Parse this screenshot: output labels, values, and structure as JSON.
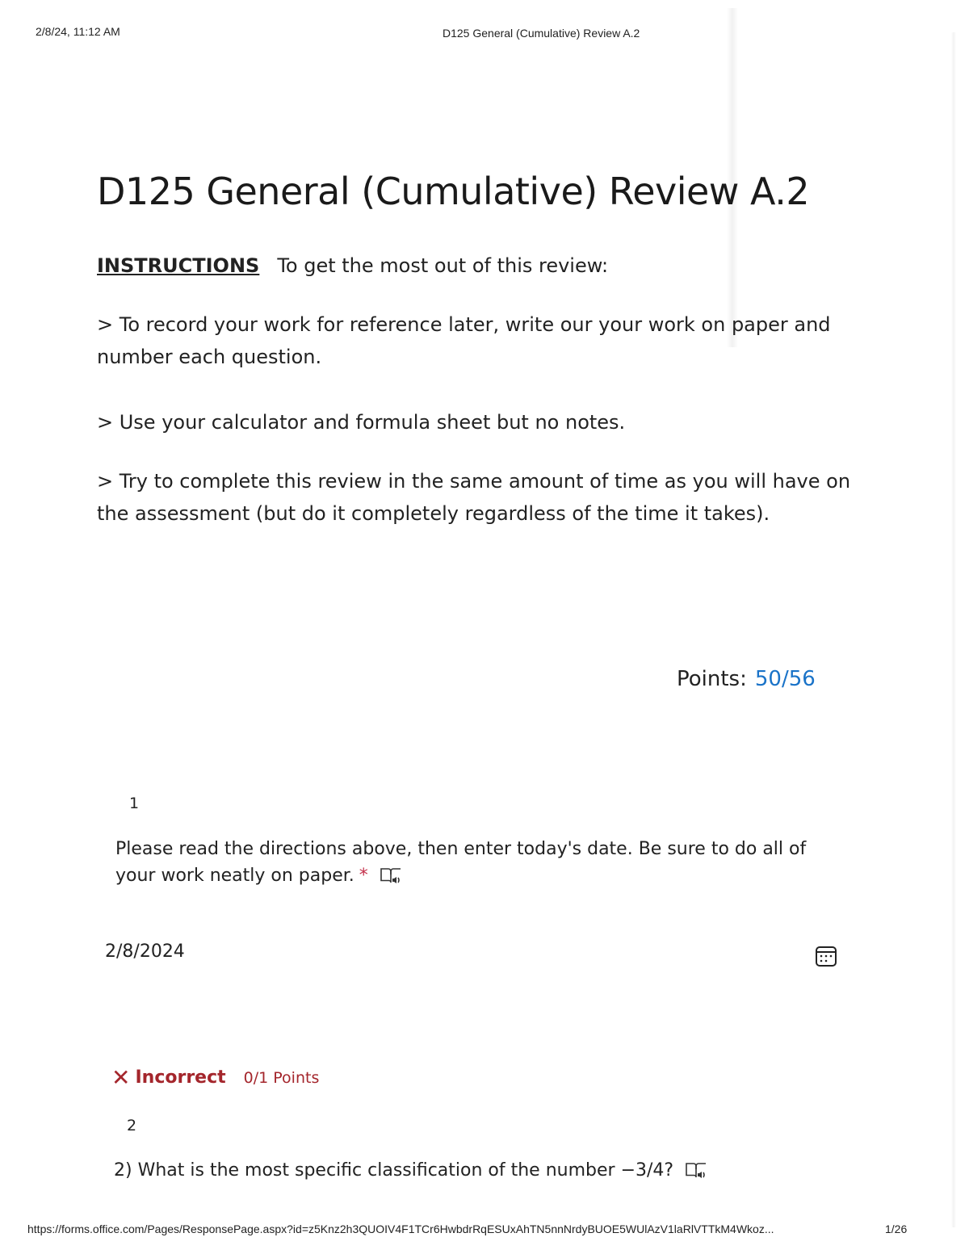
{
  "print_header": {
    "datetime": "2/8/24, 11:12 AM",
    "title": "D125 General (Cumulative) Review A.2"
  },
  "form": {
    "title": "D125 General (Cumulative) Review A.2",
    "instructions": {
      "label": "INSTRUCTIONS",
      "intro": "To get the most out of this review:",
      "items": [
        "> To record your work for reference later, write our your work on paper and number each question.",
        "> Use your calculator and formula sheet but no notes.",
        "> Try to complete this review in the same amount of time as you will have on the assessment (but do it completely regardless of the time it takes)."
      ]
    },
    "points": {
      "label": "Points:",
      "value": "50/56"
    }
  },
  "questions": [
    {
      "number": "1",
      "text": "Please read the directions above, then enter today's date.  Be sure to do all of your work neatly on paper.",
      "required_marker": "*",
      "answer": "2/8/2024",
      "icons": [
        "immersive-reader-icon",
        "calendar-icon"
      ]
    },
    {
      "number": "2",
      "result_icon": "✕",
      "result_label": "Incorrect",
      "points": "0/1 Points",
      "text": "2) What is the most specific classification of the number −3/4?",
      "icons": [
        "immersive-reader-icon"
      ]
    }
  ],
  "print_footer": {
    "url": "https://forms.office.com/Pages/ResponsePage.aspx?id=z5Knz2h3QUOIV4F1TCr6HwbdrRqESUxAhTN5nnNrdyBUOE5WUlAzV1laRlVTTkM4Wkoz...",
    "page": "1/26"
  },
  "colors": {
    "points_value": "#1a73c8",
    "incorrect": "#a4262c",
    "required": "#c4314b"
  }
}
